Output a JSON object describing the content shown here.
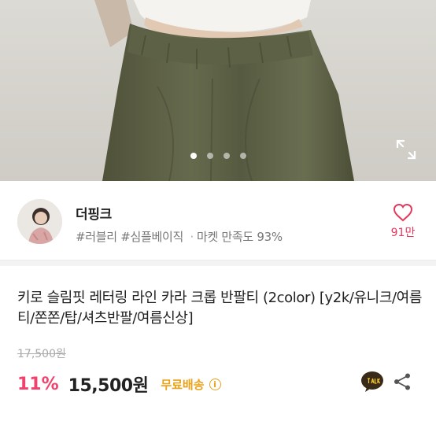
{
  "gallery": {
    "dot_count": 4,
    "active_index": 0
  },
  "seller": {
    "name": "더핑크",
    "tag1": "#러블리",
    "tag2": "#심플베이직",
    "separator": "·",
    "satisfaction": "마켓 만족도 93%",
    "like_count": "91만"
  },
  "product": {
    "title": "키로 슬림핏 레터링 라인 카라 크롭 반팔티 (2color) [y2k/유니크/여름티/쫀쫀/탑/셔츠반팔/여름신상]",
    "original_price": "17,500원",
    "discount": "11%",
    "price": "15,500원",
    "shipping": "무료배송",
    "info_glyph": "i"
  },
  "colors": {
    "discount": "#f2416c",
    "shipping": "#e9a21a",
    "like": "#e3385c",
    "talk_badge": "#3a2a1a",
    "pants": "#5b5e45"
  },
  "icons": {
    "expand": "expand-icon",
    "heart": "heart-icon",
    "info": "info-icon",
    "talk": "talk-icon",
    "share": "share-icon"
  }
}
